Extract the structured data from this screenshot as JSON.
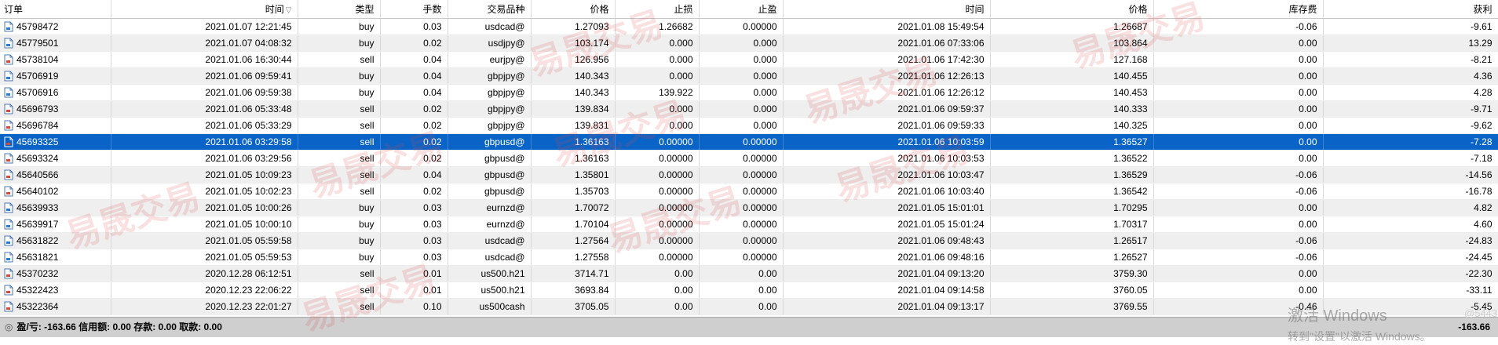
{
  "columns": [
    "订单",
    "时间",
    "类型",
    "手数",
    "交易品种",
    "价格",
    "止损",
    "止盈",
    "时间",
    "价格",
    "库存费",
    "获利"
  ],
  "sort_indicator": "▽",
  "rows": [
    [
      "45798472",
      "2021.01.07 12:21:45",
      "buy",
      "0.03",
      "usdcad@",
      "1.27093",
      "1.26682",
      "0.00000",
      "2021.01.08 15:49:54",
      "1.26687",
      "-0.06",
      "-9.61"
    ],
    [
      "45779501",
      "2021.01.07 04:08:32",
      "buy",
      "0.02",
      "usdjpy@",
      "103.174",
      "0.000",
      "0.000",
      "2021.01.06 07:33:06",
      "103.864",
      "0.00",
      "13.29"
    ],
    [
      "45738104",
      "2021.01.06 16:30:44",
      "sell",
      "0.04",
      "eurjpy@",
      "126.956",
      "0.000",
      "0.000",
      "2021.01.06 17:42:30",
      "127.168",
      "0.00",
      "-8.21"
    ],
    [
      "45706919",
      "2021.01.06 09:59:41",
      "buy",
      "0.04",
      "gbpjpy@",
      "140.343",
      "0.000",
      "0.000",
      "2021.01.06 12:26:13",
      "140.455",
      "0.00",
      "4.36"
    ],
    [
      "45706916",
      "2021.01.06 09:59:38",
      "buy",
      "0.04",
      "gbpjpy@",
      "140.343",
      "139.922",
      "0.000",
      "2021.01.06 12:26:12",
      "140.453",
      "0.00",
      "4.28"
    ],
    [
      "45696793",
      "2021.01.06 05:33:48",
      "sell",
      "0.02",
      "gbpjpy@",
      "139.834",
      "0.000",
      "0.000",
      "2021.01.06 09:59:37",
      "140.333",
      "0.00",
      "-9.71"
    ],
    [
      "45696784",
      "2021.01.06 05:33:29",
      "sell",
      "0.02",
      "gbpjpy@",
      "139.831",
      "0.000",
      "0.000",
      "2021.01.06 09:59:33",
      "140.325",
      "0.00",
      "-9.62"
    ],
    [
      "45693325",
      "2021.01.06 03:29:58",
      "sell",
      "0.02",
      "gbpusd@",
      "1.36163",
      "0.00000",
      "0.00000",
      "2021.01.06 10:03:59",
      "1.36527",
      "0.00",
      "-7.28"
    ],
    [
      "45693324",
      "2021.01.06 03:29:56",
      "sell",
      "0.02",
      "gbpusd@",
      "1.36163",
      "0.00000",
      "0.00000",
      "2021.01.06 10:03:53",
      "1.36522",
      "0.00",
      "-7.18"
    ],
    [
      "45640566",
      "2021.01.05 10:09:23",
      "sell",
      "0.04",
      "gbpusd@",
      "1.35801",
      "0.00000",
      "0.00000",
      "2021.01.06 10:03:47",
      "1.36529",
      "-0.06",
      "-14.56"
    ],
    [
      "45640102",
      "2021.01.05 10:02:23",
      "sell",
      "0.02",
      "gbpusd@",
      "1.35703",
      "0.00000",
      "0.00000",
      "2021.01.06 10:03:40",
      "1.36542",
      "-0.06",
      "-16.78"
    ],
    [
      "45639933",
      "2021.01.05 10:00:26",
      "buy",
      "0.03",
      "eurnzd@",
      "1.70072",
      "0.00000",
      "0.00000",
      "2021.01.05 15:01:01",
      "1.70295",
      "0.00",
      "4.82"
    ],
    [
      "45639917",
      "2021.01.05 10:00:10",
      "buy",
      "0.03",
      "eurnzd@",
      "1.70104",
      "0.00000",
      "0.00000",
      "2021.01.05 15:01:24",
      "1.70317",
      "0.00",
      "4.60"
    ],
    [
      "45631822",
      "2021.01.05 05:59:58",
      "buy",
      "0.03",
      "usdcad@",
      "1.27564",
      "0.00000",
      "0.00000",
      "2021.01.06 09:48:43",
      "1.26517",
      "-0.06",
      "-24.83"
    ],
    [
      "45631821",
      "2021.01.05 05:59:53",
      "buy",
      "0.03",
      "usdcad@",
      "1.27558",
      "0.00000",
      "0.00000",
      "2021.01.06 09:48:16",
      "1.26527",
      "-0.06",
      "-24.45"
    ],
    [
      "45370232",
      "2020.12.28 06:12:51",
      "sell",
      "0.01",
      "us500.h21",
      "3714.71",
      "0.00",
      "0.00",
      "2021.01.04 09:13:20",
      "3759.30",
      "0.00",
      "-22.30"
    ],
    [
      "45322423",
      "2020.12.23 22:06:22",
      "sell",
      "0.01",
      "us500.h21",
      "3693.84",
      "0.00",
      "0.00",
      "2021.01.04 09:14:58",
      "3760.05",
      "0.00",
      "-33.11"
    ],
    [
      "45322364",
      "2020.12.23 22:01:27",
      "sell",
      "0.10",
      "us500cash",
      "3705.05",
      "0.00",
      "0.00",
      "2021.01.04 09:13:17",
      "3769.55",
      "-0.46",
      "-5.45"
    ]
  ],
  "selected_index": 7,
  "footer": {
    "summary": "盈/亏: -163.66  信用额: 0.00  存款: 0.00  取款: 0.00",
    "total": "-163.66"
  },
  "watermark_text": "易晟交易",
  "os_overlay": {
    "line1": "激活 Windows",
    "line2": "转到\"设置\"以激活 Windows。",
    "weibo": "@5443..."
  }
}
